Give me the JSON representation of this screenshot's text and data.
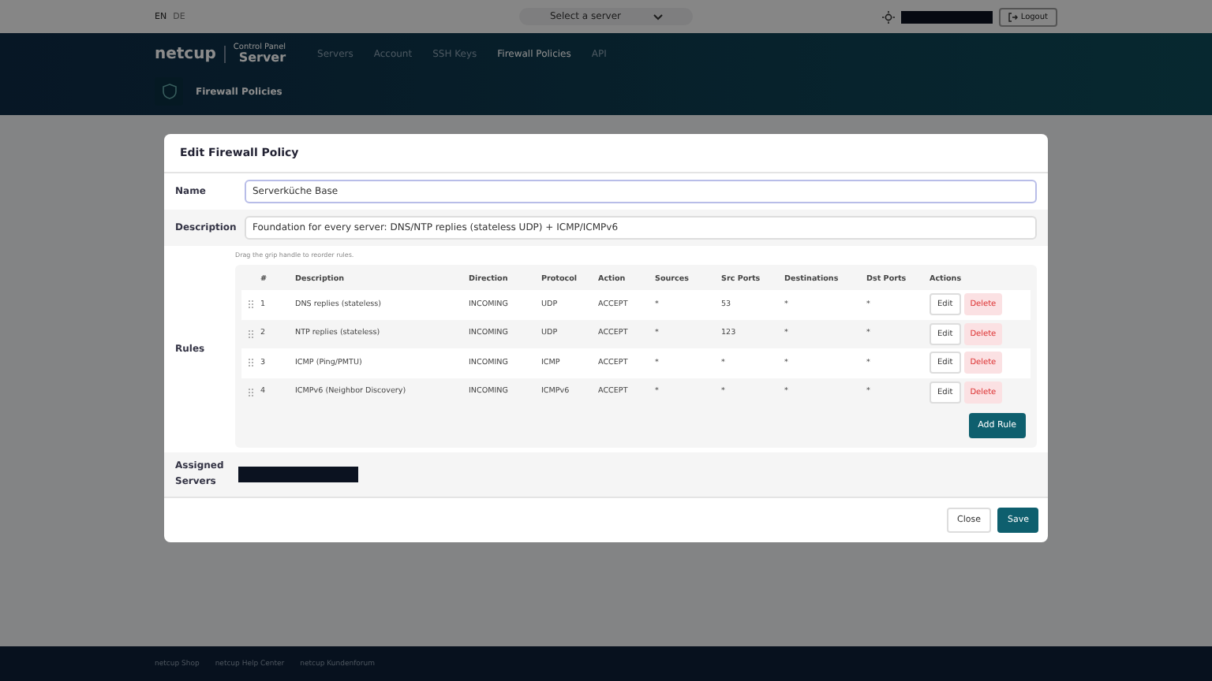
{
  "topbar": {
    "languages": [
      {
        "label": "EN",
        "selected": true
      },
      {
        "label": "DE",
        "selected": false
      }
    ],
    "server_select": {
      "placeholder": "Select a server"
    },
    "logout": "Logout"
  },
  "header": {
    "logo": {
      "brand": "netcup",
      "product": "Server",
      "tagline": "Control Panel"
    },
    "nav": [
      {
        "label": "Servers",
        "selected": false
      },
      {
        "label": "Account",
        "selected": false
      },
      {
        "label": "SSH Keys",
        "selected": false
      },
      {
        "label": "Firewall Policies",
        "selected": true
      },
      {
        "label": "API",
        "selected": false
      }
    ],
    "page_title": "Firewall Policies"
  },
  "modal": {
    "title": "Edit Firewall Policy",
    "fields": [
      {
        "label": "Name",
        "value": "Serverküche Base",
        "focused": true
      },
      {
        "label": "Description",
        "value": "Foundation for every server: DNS/NTP replies (stateless UDP) + ICMP/ICMPv6",
        "focused": false
      }
    ],
    "rules_label": "Rules",
    "hint": "Drag the grip handle to reorder rules.",
    "columns": [
      "#",
      "Description",
      "Direction",
      "Protocol",
      "Action",
      "Sources",
      "Src Ports",
      "Destinations",
      "Dst Ports",
      "Actions"
    ],
    "rows": [
      {
        "num": "1",
        "description": "DNS replies (stateless)",
        "direction": "INCOMING",
        "protocol": "UDP",
        "action": "ACCEPT",
        "sources": "*",
        "src_ports": "53",
        "destinations": "*",
        "dst_ports": "*",
        "edit": "Edit",
        "delete": "Delete"
      },
      {
        "num": "2",
        "description": "NTP replies (stateless)",
        "direction": "INCOMING",
        "protocol": "UDP",
        "action": "ACCEPT",
        "sources": "*",
        "src_ports": "123",
        "destinations": "*",
        "dst_ports": "*",
        "edit": "Edit",
        "delete": "Delete"
      },
      {
        "num": "3",
        "description": "ICMP (Ping/PMTU)",
        "direction": "INCOMING",
        "protocol": "ICMP",
        "action": "ACCEPT",
        "sources": "*",
        "src_ports": "*",
        "destinations": "*",
        "dst_ports": "*",
        "edit": "Edit",
        "delete": "Delete"
      },
      {
        "num": "4",
        "description": "ICMPv6 (Neighbor Discovery)",
        "direction": "INCOMING",
        "protocol": "ICMPv6",
        "action": "ACCEPT",
        "sources": "*",
        "src_ports": "*",
        "destinations": "*",
        "dst_ports": "*",
        "edit": "Edit",
        "delete": "Delete"
      }
    ],
    "add_rule": "Add Rule",
    "assigned_label": "Assigned Servers",
    "buttons": [
      {
        "label": "Close",
        "kind": "secondary"
      },
      {
        "label": "Save",
        "kind": "primary"
      }
    ]
  },
  "footer": {
    "links": [
      "netcup Shop",
      "netcup Help Center",
      "netcup Kundenforum"
    ]
  }
}
